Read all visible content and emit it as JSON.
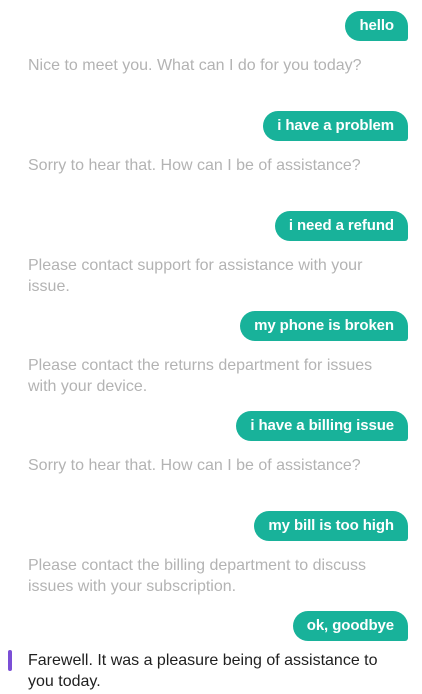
{
  "conversation": {
    "messages": [
      {
        "from": "user",
        "text": "hello"
      },
      {
        "from": "bot",
        "text": "Nice to meet you. What can I do for you today?"
      },
      {
        "from": "user",
        "text": "i have a problem"
      },
      {
        "from": "bot",
        "text": "Sorry to hear that. How can I be of assistance?"
      },
      {
        "from": "user",
        "text": "i need a refund"
      },
      {
        "from": "bot",
        "text": "Please contact support for assistance with your issue."
      },
      {
        "from": "user",
        "text": "my phone is broken"
      },
      {
        "from": "bot",
        "text": "Please contact the returns department for issues with your device."
      },
      {
        "from": "user",
        "text": "i have a billing issue"
      },
      {
        "from": "bot",
        "text": "Sorry to hear that. How can I be of assistance?"
      },
      {
        "from": "user",
        "text": "my bill is too high"
      },
      {
        "from": "bot",
        "text": "Please contact the billing department to discuss issues with your subscription."
      },
      {
        "from": "user",
        "text": "ok, goodbye"
      },
      {
        "from": "bot",
        "text": "Farewell. It was a pleasure being of assistance to you today."
      }
    ]
  },
  "colors": {
    "user_bubble": "#18b29a",
    "user_text": "#ffffff",
    "bot_text_past": "#b3b3b3",
    "bot_text_latest": "#1f1f1f",
    "active_marker": "#7b4fd6"
  }
}
